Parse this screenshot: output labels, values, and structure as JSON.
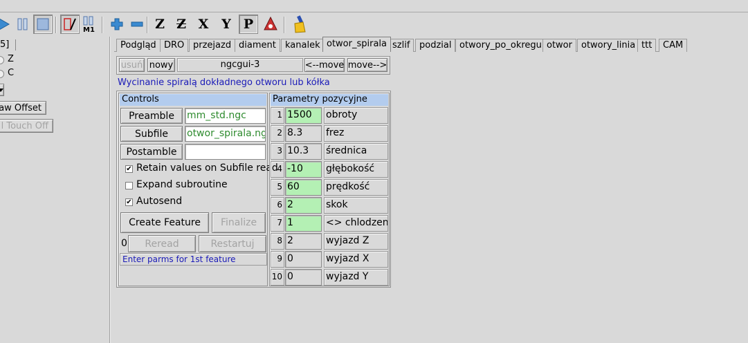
{
  "toolbar": {
    "icons": [
      "play-icon",
      "pause-icon",
      "stop-icon",
      "block-delete-icon",
      "optional-stop-icon",
      "zoom-in-icon",
      "zoom-out-icon",
      "view-z-icon",
      "view-z2-icon",
      "view-x-icon",
      "view-y-icon",
      "view-p-icon",
      "rotate-icon",
      "clear-plot-icon"
    ],
    "letters": {
      "z": "Z",
      "z2": "Z",
      "x": "X",
      "y": "Y",
      "p": "P",
      "m1": "M1"
    }
  },
  "left_panel": {
    "header_text": "5]",
    "radio_z": "Z",
    "radio_c": "C",
    "draw_offset": "aw Offset",
    "touch_off": "l Touch Off"
  },
  "tabs": [
    "Podgląd",
    "DRO",
    "przejazd",
    "diament",
    "kanalek",
    "otwor_spirala",
    "szlif",
    "podzial",
    "otwory_po_okregu",
    "otwor",
    "otwory_linia",
    "ttt",
    "CAM"
  ],
  "active_tab": "otwor_spirala",
  "page_bar": {
    "remove": "usuń",
    "new": "nowy",
    "page_name": "ngcgui-3",
    "move_left": "<--move",
    "move_right": "move-->"
  },
  "description": "Wycinanie spiralą dokładnego otworu lub kółka",
  "controls": {
    "header": "Controls",
    "preamble_label": "Preamble",
    "preamble_value": "mm_std.ngc",
    "subfile_label": "Subfile",
    "subfile_value": "otwor_spirala.ngc",
    "postamble_label": "Postamble",
    "postamble_value": "",
    "retain_label": "Retain values on Subfile read",
    "expand_label": "Expand subroutine",
    "autosend_label": "Autosend",
    "checked_mark": "✔",
    "create_feature": "Create Feature",
    "finalize": "Finalize",
    "counter": "0",
    "reread": "Reread",
    "restart": "Restartuj",
    "status": "Enter parms for 1st feature"
  },
  "params": {
    "header": "Parametry pozycyjne",
    "rows": [
      {
        "num": "1",
        "value": "1500",
        "label": "obroty"
      },
      {
        "num": "2",
        "value": "8.3",
        "label": "frez"
      },
      {
        "num": "3",
        "value": "10.3",
        "label": "średnica"
      },
      {
        "num": "4",
        "value": "-10",
        "label": "głębokość"
      },
      {
        "num": "5",
        "value": "60",
        "label": "prędkość"
      },
      {
        "num": "6",
        "value": "2",
        "label": "skok"
      },
      {
        "num": "7",
        "value": "1",
        "label": "<> chlodzenie"
      },
      {
        "num": "8",
        "value": "2",
        "label": "wyjazd Z"
      },
      {
        "num": "9",
        "value": "0",
        "label": "wyjazd X"
      },
      {
        "num": "10",
        "value": "0",
        "label": "wyjazd Y"
      }
    ]
  },
  "colors": {
    "background": "#d9d9d9",
    "header_blue": "#b3ccee",
    "green_field": "#b4f0b4",
    "green_text": "#2e8b2e",
    "blue_text": "#1a1ab8"
  }
}
